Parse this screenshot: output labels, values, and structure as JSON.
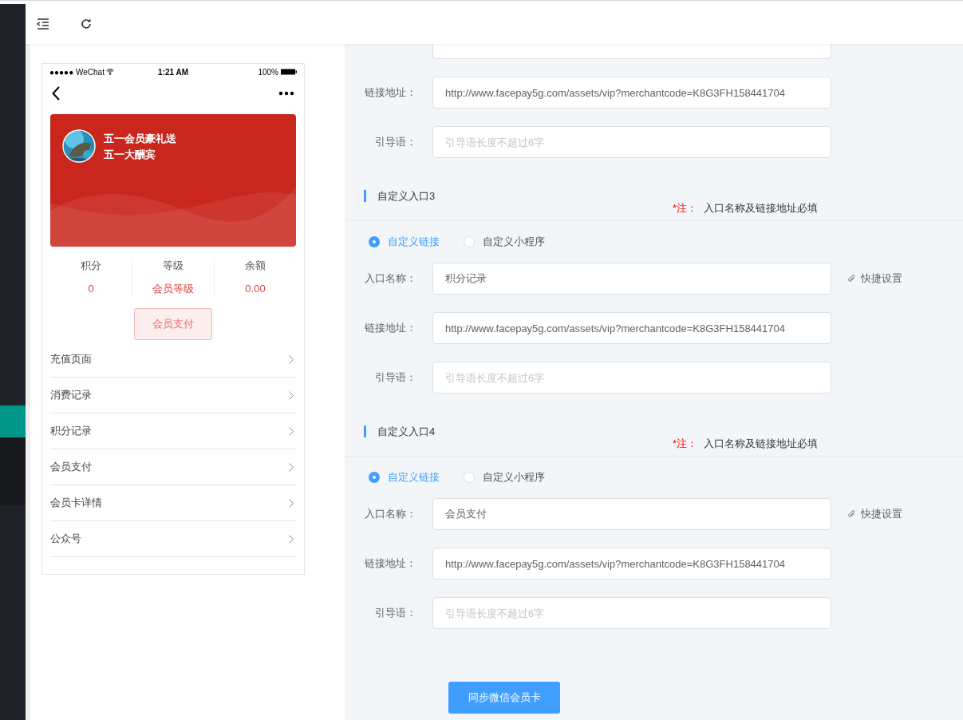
{
  "phone": {
    "status_bar": {
      "carrier": "●●●●● WeChat",
      "time": "1:21 AM",
      "battery": "100%"
    },
    "card": {
      "lines": [
        "五一会员豪礼送",
        "五一大酬宾"
      ]
    },
    "stats": [
      {
        "label": "积分",
        "value": "0"
      },
      {
        "label": "等级",
        "value": "会员等级"
      },
      {
        "label": "余额",
        "value": "0.00"
      }
    ],
    "pay_button": "会员支付",
    "menu": [
      "充值页面",
      "消费记录",
      "积分记录",
      "会员支付",
      "会员卡详情",
      "公众号"
    ]
  },
  "sections": [
    {
      "fields": [
        {
          "kind": "covered"
        },
        {
          "label": "链接地址：",
          "value": "http://www.facepay5g.com/assets/vip?merchantcode=K8G3FH158441704"
        },
        {
          "label": "引导语：",
          "placeholder": "引导语长度不超过6字"
        }
      ]
    },
    {
      "title": "自定义入口3",
      "note_mark": "*注：",
      "note": "入口名称及链接地址必填",
      "radios": [
        {
          "label": "自定义链接",
          "selected": true
        },
        {
          "label": "自定义小程序",
          "selected": false
        }
      ],
      "fields": [
        {
          "label": "入口名称：",
          "value": "积分记录",
          "shortcut": "快捷设置"
        },
        {
          "label": "链接地址：",
          "value": "http://www.facepay5g.com/assets/vip?merchantcode=K8G3FH158441704"
        },
        {
          "label": "引导语：",
          "placeholder": "引导语长度不超过6字"
        }
      ]
    },
    {
      "title": "自定义入口4",
      "note_mark": "*注：",
      "note": "入口名称及链接地址必填",
      "radios": [
        {
          "label": "自定义链接",
          "selected": true
        },
        {
          "label": "自定义小程序",
          "selected": false
        }
      ],
      "fields": [
        {
          "label": "入口名称：",
          "value": "会员支付",
          "shortcut": "快捷设置"
        },
        {
          "label": "链接地址：",
          "value": "http://www.facepay5g.com/assets/vip?merchantcode=K8G3FH158441704"
        },
        {
          "label": "引导语：",
          "placeholder": "引导语长度不超过6字"
        }
      ]
    }
  ],
  "sync_button": "同步微信会员卡"
}
